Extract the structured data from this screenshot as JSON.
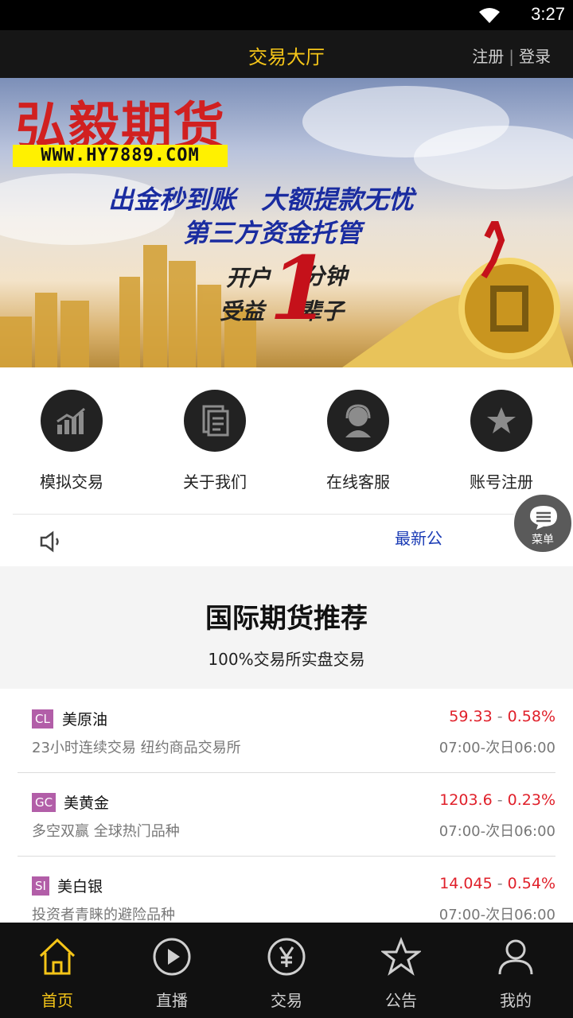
{
  "status": {
    "time": "3:27"
  },
  "topbar": {
    "title": "交易大厅",
    "register": "注册",
    "separator": "|",
    "login": "登录"
  },
  "banner": {
    "brand": "弘毅期货",
    "url": "WWW.HY7889.COM",
    "line1": "出金秒到账　大额提款无忧",
    "line2": "第三方资金托管",
    "line3a": "开户",
    "line3b": "分钟",
    "line4a": "受益",
    "line4b": "辈子",
    "big": "1",
    "pages": 4,
    "active_page": 1
  },
  "quick": [
    {
      "label": "模拟交易",
      "icon": "trend-chart-icon"
    },
    {
      "label": "关于我们",
      "icon": "document-icon"
    },
    {
      "label": "在线客服",
      "icon": "customer-service-icon"
    },
    {
      "label": "账号注册",
      "icon": "star-icon"
    }
  ],
  "notice": {
    "text": "最新公"
  },
  "menu": {
    "label": "菜单"
  },
  "section": {
    "title": "国际期货推荐",
    "subtitle": "100%交易所实盘交易"
  },
  "products": [
    {
      "code": "CL",
      "name": "美原油",
      "price": "59.33",
      "dash": "-",
      "change": "0.58%",
      "desc": "23小时连续交易 纽约商品交易所",
      "hours": "07:00-次日06:00"
    },
    {
      "code": "GC",
      "name": "美黄金",
      "price": "1203.6",
      "dash": "-",
      "change": "0.23%",
      "desc": "多空双赢 全球热门品种",
      "hours": "07:00-次日06:00"
    },
    {
      "code": "SI",
      "name": "美白银",
      "price": "14.045",
      "dash": "-",
      "change": "0.54%",
      "desc": "投资者青睐的避险品种",
      "hours": "07:00-次日06:00"
    }
  ],
  "tabs": [
    {
      "label": "首页",
      "icon": "home-icon",
      "active": true
    },
    {
      "label": "直播",
      "icon": "play-icon",
      "active": false
    },
    {
      "label": "交易",
      "icon": "yen-icon",
      "active": false
    },
    {
      "label": "公告",
      "icon": "star-outline-icon",
      "active": false
    },
    {
      "label": "我的",
      "icon": "user-icon",
      "active": false
    }
  ],
  "colors": {
    "accent": "#f5c518",
    "price_red": "#e0202a",
    "badge": "#b25ea8",
    "notice_blue": "#1a3bb5"
  }
}
